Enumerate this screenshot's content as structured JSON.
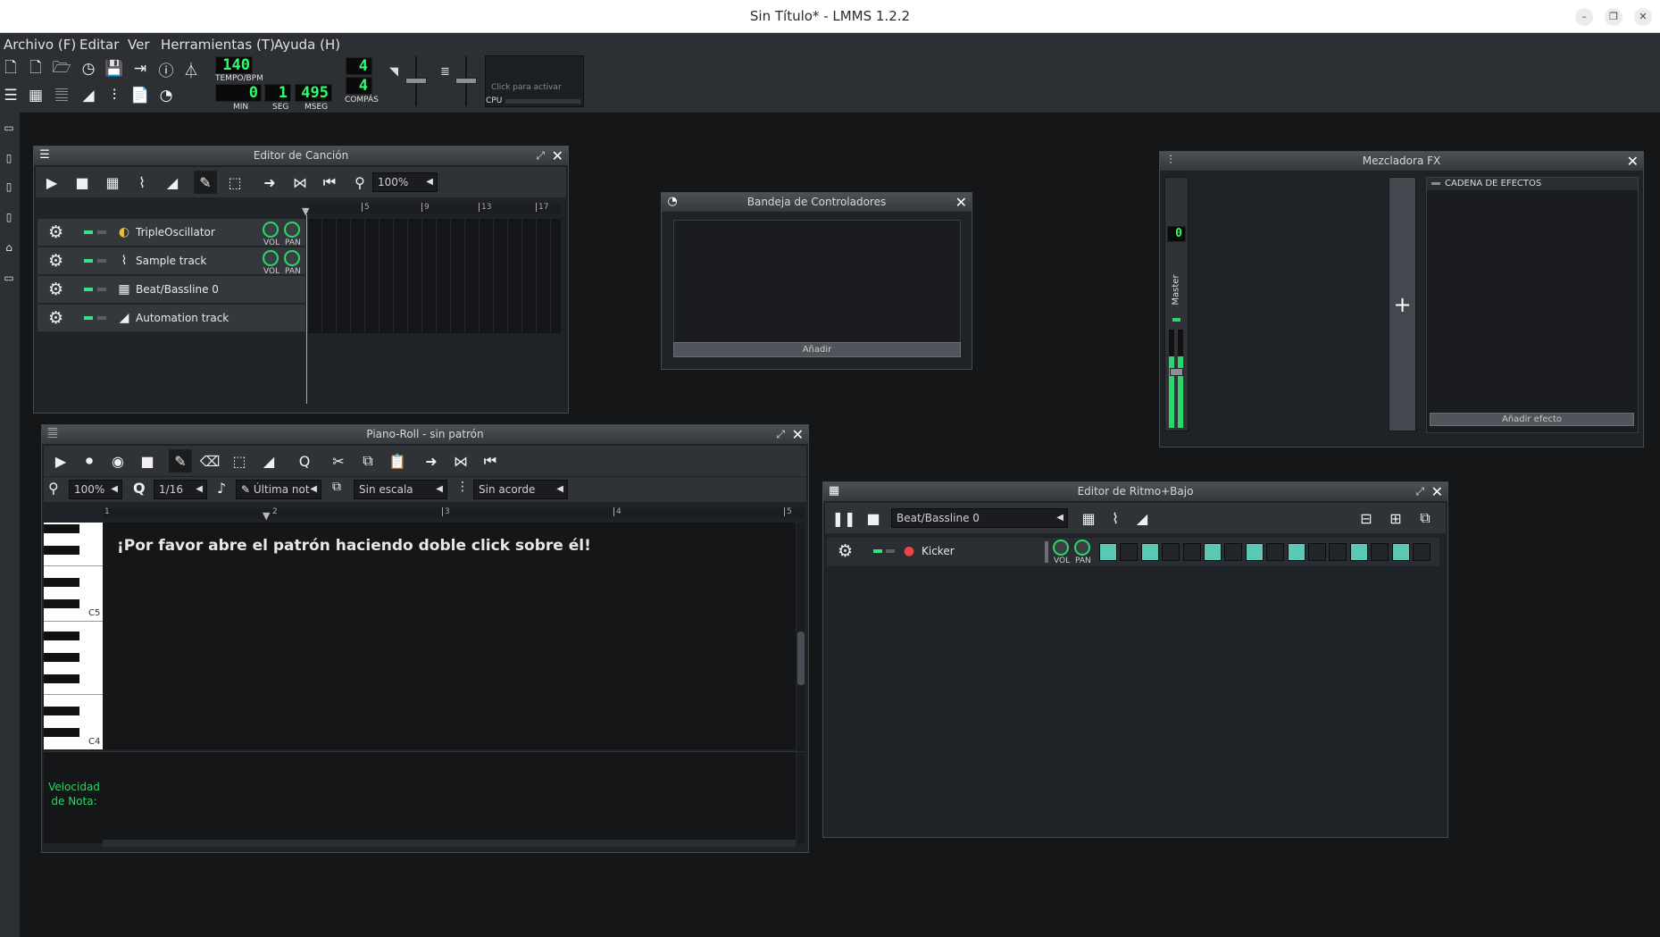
{
  "app": {
    "window_title": "Sin Título* - LMMS 1.2.2"
  },
  "menu": [
    "Archivo (F)",
    "Editar",
    "Ver",
    "Herramientas (T)",
    "Ayuda (H)"
  ],
  "transport": {
    "tempo": "140",
    "tempo_label": "TEMPO/BPM",
    "min": "0",
    "min_label": "MIN",
    "sec": "1",
    "sec_label": "SEG",
    "msec": "495",
    "msec_label": "MSEG",
    "ts_num": "4",
    "ts_den": "4",
    "ts_label": "COMPÁS",
    "cpu_label": "CPU",
    "cpu_hint": "Click para activar"
  },
  "song_editor": {
    "title": "Editor de Canción",
    "zoom": "100%",
    "ruler": [
      "5",
      "9",
      "13",
      "17"
    ],
    "knob_vol": "VOL",
    "knob_pan": "PAN",
    "tracks": [
      {
        "name": "TripleOscillator",
        "icon": "triple-oscillator-icon"
      },
      {
        "name": "Sample track",
        "icon": "waveform-icon"
      },
      {
        "name": "Beat/Bassline 0",
        "icon": "beat-grid-icon"
      },
      {
        "name": "Automation track",
        "icon": "automation-ramp-icon"
      }
    ]
  },
  "controller_rack": {
    "title": "Bandeja de Controladores",
    "add_button": "Añadir"
  },
  "fx_mixer": {
    "title": "Mezcladora FX",
    "master_label": "Master",
    "master_value": "0",
    "effects_chain_label": "CADENA DE EFECTOS",
    "add_effect_button": "Añadir efecto"
  },
  "piano_roll": {
    "title": "Piano-Roll - sin patrón",
    "zoom": "100%",
    "quantize": "1/16",
    "note_length": "Última not",
    "scale": "Sin escala",
    "chord": "Sin acorde",
    "ruler": [
      "1",
      "2",
      "3",
      "4",
      "5"
    ],
    "key_c5": "C5",
    "key_c4": "C4",
    "message": "¡Por favor abre el patrón haciendo doble click sobre él!",
    "velocity_label_1": "Velocidad",
    "velocity_label_2": "de Nota:"
  },
  "bb_editor": {
    "title": "Editor de Ritmo+Bajo",
    "pattern": "Beat/Bassline 0",
    "track_name": "Kicker",
    "knob_vol": "VOL",
    "knob_pan": "PAN",
    "steps": [
      1,
      0,
      1,
      0,
      0,
      1,
      0,
      1,
      0,
      1,
      0,
      0,
      1,
      0,
      1,
      0
    ]
  },
  "colors": {
    "accent_green": "#2bd66a",
    "step_on": "#5bc9b5",
    "velocity_text": "#2bd66a"
  }
}
